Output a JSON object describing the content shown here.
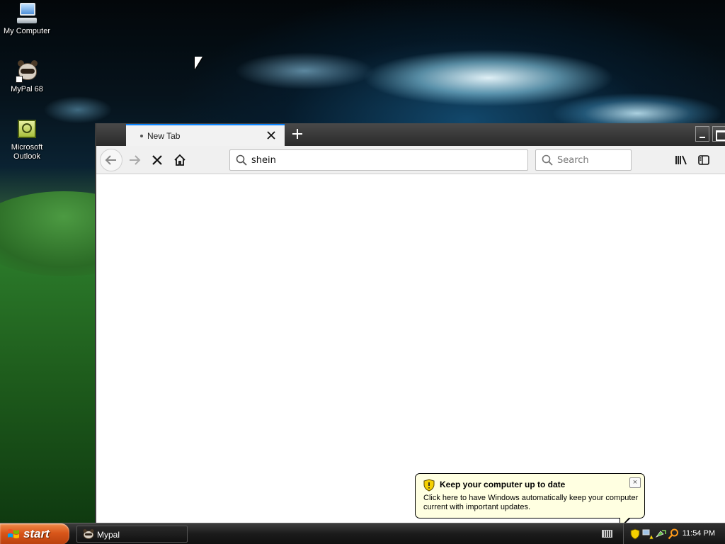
{
  "desktop": {
    "icons": [
      {
        "label": "My Computer"
      },
      {
        "label": "MyPal 68"
      },
      {
        "label": "Microsoft Outlook"
      }
    ]
  },
  "browser": {
    "tab_title": "New Tab",
    "url_value": "shein",
    "search_placeholder": "Search"
  },
  "balloon": {
    "title": "Keep your computer up to date",
    "body": "Click here to have Windows automatically keep your computer current with important updates.",
    "close_glyph": "×"
  },
  "taskbar": {
    "start_label": "start",
    "task_label": "Mypal",
    "clock": "11:54 PM"
  },
  "colors": {
    "tab_accent": "#0a84ff",
    "balloon_bg": "#ffffe1",
    "start_orange": "#d8561a"
  }
}
